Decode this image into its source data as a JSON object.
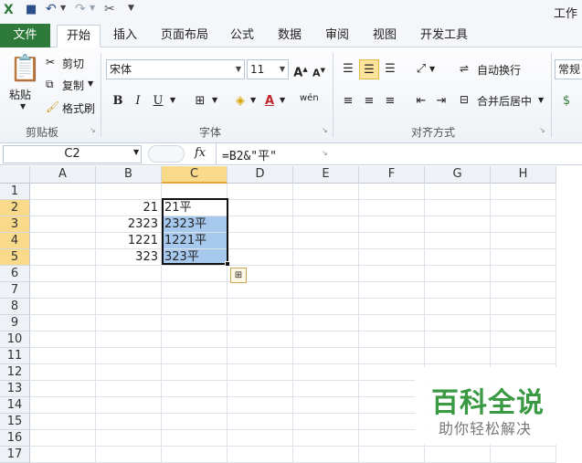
{
  "qat": {
    "title": "工作簿"
  },
  "tabs": {
    "file": "文件",
    "home": "开始",
    "insert": "插入",
    "layout": "页面布局",
    "formulas": "公式",
    "data": "数据",
    "review": "审阅",
    "view": "视图",
    "developer": "开发工具"
  },
  "ribbon": {
    "clipboard": {
      "paste": "粘贴",
      "cut": "剪切",
      "copy": "复制",
      "format_painter": "格式刷",
      "group_label": "剪贴板"
    },
    "font": {
      "name": "宋体",
      "size": "11",
      "bold": "B",
      "italic": "I",
      "underline": "U",
      "phonetic": "wén",
      "group_label": "字体"
    },
    "alignment": {
      "wrap_text": "自动换行",
      "merge_center": "合并后居中",
      "group_label": "对齐方式"
    },
    "number": {
      "format": "常规"
    }
  },
  "formula_bar": {
    "name_box": "C2",
    "fx": "fx",
    "formula": "=B2&\"平\""
  },
  "sheet": {
    "columns": [
      "A",
      "B",
      "C",
      "D",
      "E",
      "F",
      "G",
      "H"
    ],
    "rows": [
      "1",
      "2",
      "3",
      "4",
      "5",
      "6",
      "7",
      "8",
      "9",
      "10",
      "11",
      "12",
      "13",
      "14",
      "15",
      "16",
      "17"
    ],
    "active_column": "C",
    "b_values": [
      "21",
      "2323",
      "1221",
      "323"
    ],
    "c_values": [
      "21平",
      "2323平",
      "1221平",
      "323平"
    ]
  },
  "watermark": {
    "title": "百科全说",
    "subtitle": "助你轻松解决"
  }
}
